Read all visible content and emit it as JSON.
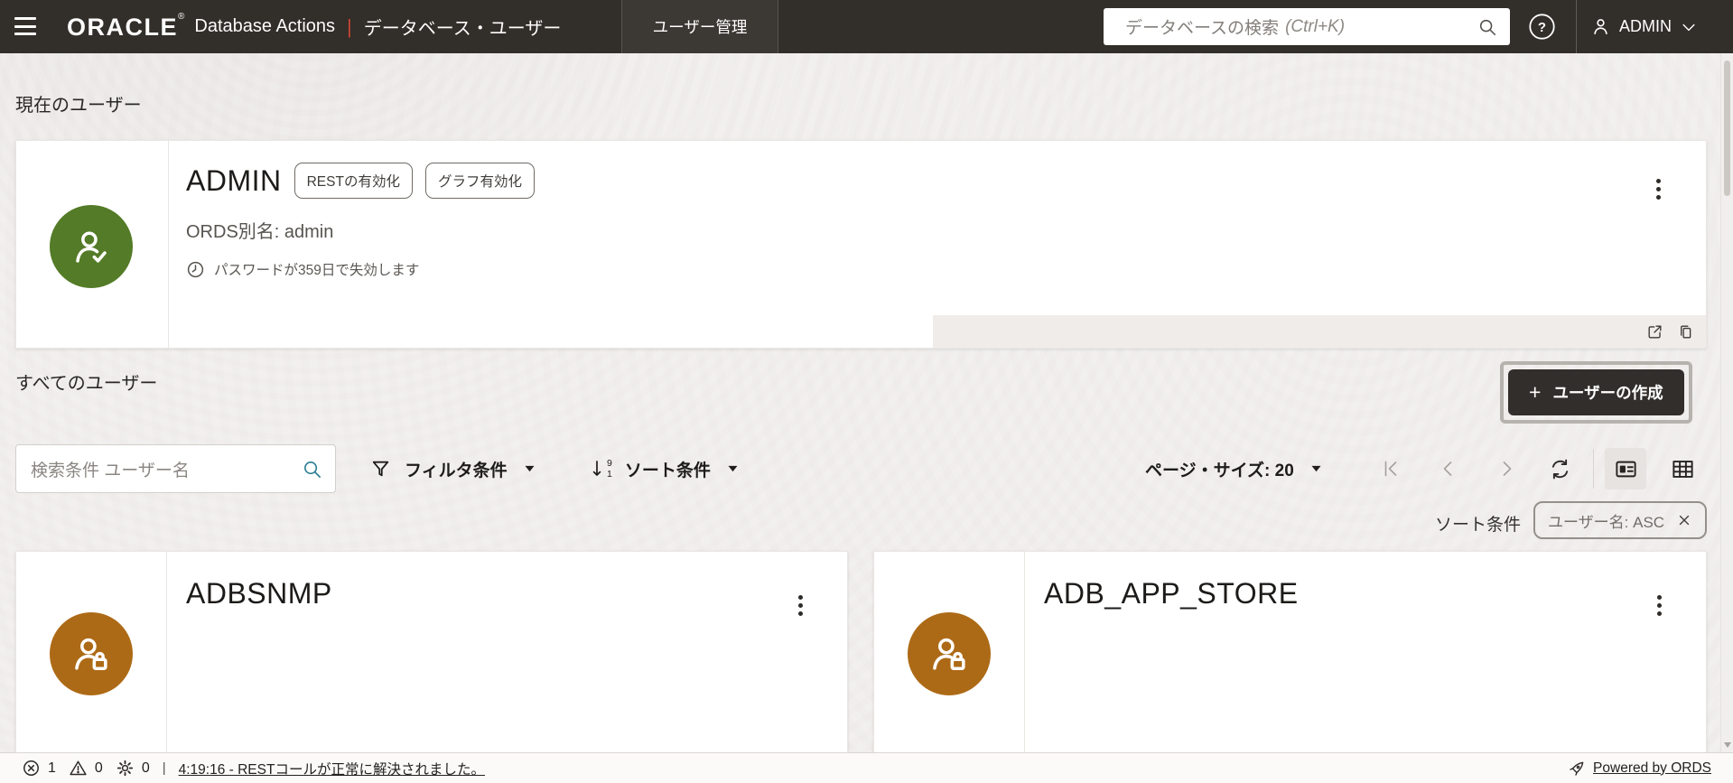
{
  "header": {
    "brand": "ORACLE",
    "brand_reg": "®",
    "product": "Database Actions",
    "separator": "|",
    "context": "データベース・ユーザー",
    "tab": "ユーザー管理",
    "search_placeholder_main": "データベースの検索",
    "search_placeholder_hint": "(Ctrl+K)",
    "user": "ADMIN"
  },
  "icons": {
    "help_glyph": "?",
    "sort_top": "9",
    "sort_bottom": "1"
  },
  "current_user": {
    "title": "現在のユーザー",
    "name": "ADMIN",
    "badges": [
      "RESTの有効化",
      "グラフ有効化"
    ],
    "ords_alias": "ORDS別名: admin",
    "password_note": "パスワードが359日で失効します"
  },
  "all_users": {
    "title": "すべてのユーザー",
    "create_plus": "+",
    "create_label": "ユーザーの作成"
  },
  "toolbar": {
    "search_placeholder": "検索条件 ユーザー名",
    "filter_label": "フィルタ条件",
    "sort_label": "ソート条件",
    "page_size_label": "ページ・サイズ: 20"
  },
  "sort_bar": {
    "label": "ソート条件",
    "chip_value": "ユーザー名: ASC"
  },
  "users": [
    {
      "name": "ADBSNMP"
    },
    {
      "name": "ADB_APP_STORE"
    }
  ],
  "status_bar": {
    "errors": "1",
    "warnings": "0",
    "processes": "0",
    "separator": "|",
    "message": "4:19:16 - RESTコールが正常に解決されました。",
    "powered_by": "Powered by ORDS"
  },
  "colors": {
    "header_bg": "#322e2a",
    "accent_red": "#c74634",
    "avatar_green": "#547b27",
    "avatar_orange": "#ad6a16",
    "search_icon_teal": "#2a7d92",
    "button_dark": "#322e2b"
  }
}
